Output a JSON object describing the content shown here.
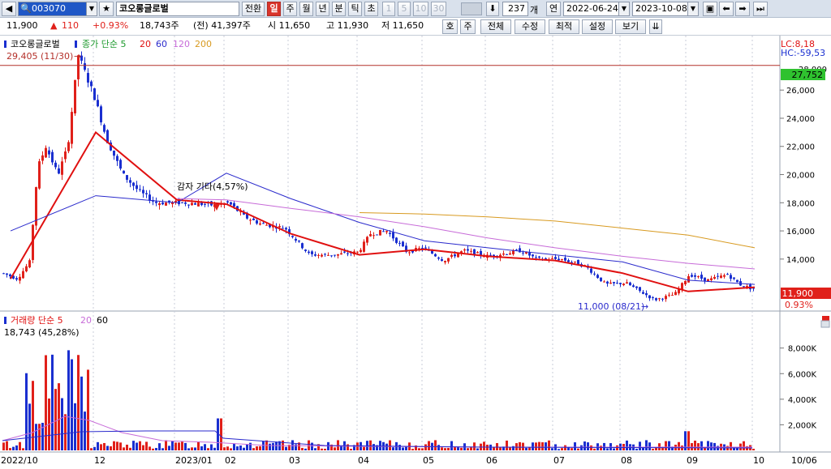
{
  "toolbar": {
    "code": "003070",
    "name": "코오롱글로벌",
    "convert": "전환",
    "periods": [
      "일",
      "주",
      "월",
      "년",
      "분",
      "틱",
      "초"
    ],
    "intervals": [
      "1",
      "5",
      "10",
      "30"
    ],
    "count": "237",
    "count_unit": "개",
    "link_label": "연",
    "date_from": "2022-06-24",
    "date_to": "2023-10-08"
  },
  "infobar": {
    "price": "11,900",
    "change": "110",
    "change_pct": "+0.93%",
    "volume": "18,743주",
    "prev_volume": "(전) 41,397주",
    "open": "시 11,650",
    "high": "고 11,930",
    "low": "저 11,650",
    "buttons": [
      "호",
      "주",
      "전체",
      "수정",
      "최적",
      "설정",
      "보기"
    ]
  },
  "chart": {
    "legend_name": "코오롱글로벌",
    "legend_ma": "종가 단순 5",
    "legend_ma_periods": [
      "20",
      "60",
      "120",
      "200"
    ],
    "lc": "LC:8,18",
    "hc": "HC:-59,53",
    "top_label": "29,405 (11/30)",
    "max_line_value": "27,752",
    "current_value": "11,900",
    "current_pct": "0.93%",
    "low_label": "11,000 (08/21)",
    "annotation": "감자 기타(4,57%)",
    "cut_label": "28,000",
    "y_ticks": [
      "26,000",
      "24,000",
      "22,000",
      "20,000",
      "18,000",
      "16,000",
      "14,000"
    ],
    "vol_legend": "거래량 단순 5",
    "vol_legend_periods": [
      "20",
      "60"
    ],
    "vol_value": "18,743 (45,28%)",
    "vol_ticks": [
      "8,000K",
      "6,000K",
      "4,000K",
      "2,000K"
    ],
    "x_ticks": [
      "2022/10",
      "12",
      "2023/01",
      "02",
      "03",
      "04",
      "05",
      "06",
      "07",
      "08",
      "09",
      "10"
    ],
    "x_end": "10/06"
  },
  "colors": {
    "up": "#e0201a",
    "down": "#1a2fd0",
    "ma5": "#1e9a2e",
    "ma20": "#e01010",
    "ma60": "#2a2acc",
    "ma120": "#c76bd8",
    "ma200": "#d89a20"
  },
  "chart_data": {
    "type": "line",
    "title": "코오롱글로벌",
    "ylim": [
      11000,
      29405
    ],
    "series": [
      {
        "name": "20",
        "x": [
          "2022/10",
          "12",
          "2023/01",
          "02",
          "03",
          "04",
          "05",
          "06",
          "07",
          "08",
          "09",
          "10"
        ],
        "values": [
          12600,
          23000,
          18200,
          17900,
          15800,
          14300,
          14700,
          14200,
          13900,
          13000,
          11700,
          12000
        ]
      },
      {
        "name": "60",
        "x": [
          "2022/10",
          "12",
          "2023/01",
          "02",
          "03",
          "04",
          "05",
          "06",
          "07",
          "08",
          "09",
          "10"
        ],
        "values": [
          16000,
          18500,
          18000,
          20100,
          18300,
          16600,
          15300,
          14800,
          14300,
          13800,
          12500,
          12200
        ]
      },
      {
        "name": "120",
        "x": [
          "2023/01",
          "02",
          "03",
          "04",
          "05",
          "06",
          "07",
          "08",
          "09",
          "10"
        ],
        "values": [
          18300,
          18200,
          17600,
          17000,
          16300,
          15500,
          14800,
          14200,
          13700,
          13300
        ]
      },
      {
        "name": "200",
        "x": [
          "04",
          "05",
          "06",
          "07",
          "08",
          "09",
          "10"
        ],
        "values": [
          17300,
          17200,
          17000,
          16700,
          16200,
          15700,
          14800
        ]
      }
    ],
    "markers": {
      "high": 29405,
      "low": 11000,
      "last": 11900,
      "hline": 27752
    },
    "volume": {
      "last": 18743,
      "unit": "K",
      "ylim": [
        0,
        9500
      ]
    }
  }
}
